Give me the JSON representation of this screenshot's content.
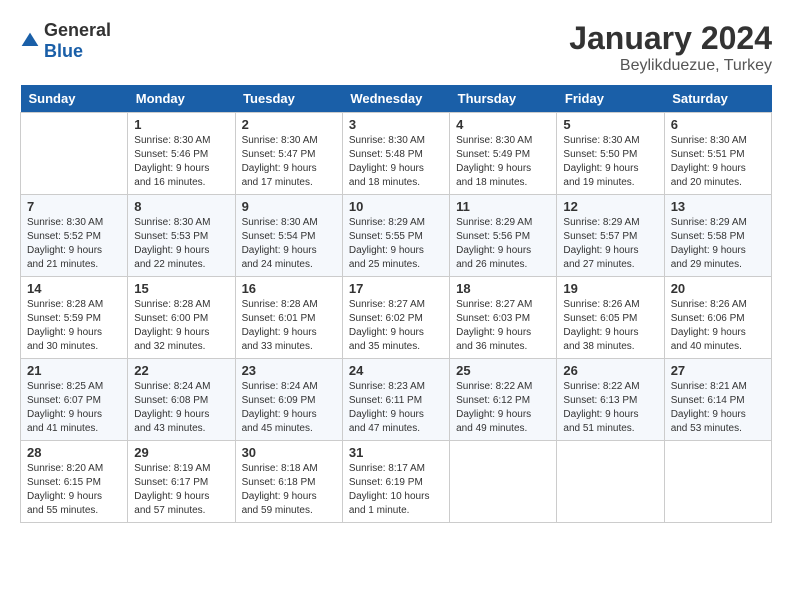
{
  "header": {
    "logo_general": "General",
    "logo_blue": "Blue",
    "month": "January 2024",
    "location": "Beylikduezue, Turkey"
  },
  "days_of_week": [
    "Sunday",
    "Monday",
    "Tuesday",
    "Wednesday",
    "Thursday",
    "Friday",
    "Saturday"
  ],
  "weeks": [
    [
      {
        "day": "",
        "sunrise": "",
        "sunset": "",
        "daylight": ""
      },
      {
        "day": "1",
        "sunrise": "Sunrise: 8:30 AM",
        "sunset": "Sunset: 5:46 PM",
        "daylight": "Daylight: 9 hours and 16 minutes."
      },
      {
        "day": "2",
        "sunrise": "Sunrise: 8:30 AM",
        "sunset": "Sunset: 5:47 PM",
        "daylight": "Daylight: 9 hours and 17 minutes."
      },
      {
        "day": "3",
        "sunrise": "Sunrise: 8:30 AM",
        "sunset": "Sunset: 5:48 PM",
        "daylight": "Daylight: 9 hours and 18 minutes."
      },
      {
        "day": "4",
        "sunrise": "Sunrise: 8:30 AM",
        "sunset": "Sunset: 5:49 PM",
        "daylight": "Daylight: 9 hours and 18 minutes."
      },
      {
        "day": "5",
        "sunrise": "Sunrise: 8:30 AM",
        "sunset": "Sunset: 5:50 PM",
        "daylight": "Daylight: 9 hours and 19 minutes."
      },
      {
        "day": "6",
        "sunrise": "Sunrise: 8:30 AM",
        "sunset": "Sunset: 5:51 PM",
        "daylight": "Daylight: 9 hours and 20 minutes."
      }
    ],
    [
      {
        "day": "7",
        "sunrise": "Sunrise: 8:30 AM",
        "sunset": "Sunset: 5:52 PM",
        "daylight": "Daylight: 9 hours and 21 minutes."
      },
      {
        "day": "8",
        "sunrise": "Sunrise: 8:30 AM",
        "sunset": "Sunset: 5:53 PM",
        "daylight": "Daylight: 9 hours and 22 minutes."
      },
      {
        "day": "9",
        "sunrise": "Sunrise: 8:30 AM",
        "sunset": "Sunset: 5:54 PM",
        "daylight": "Daylight: 9 hours and 24 minutes."
      },
      {
        "day": "10",
        "sunrise": "Sunrise: 8:29 AM",
        "sunset": "Sunset: 5:55 PM",
        "daylight": "Daylight: 9 hours and 25 minutes."
      },
      {
        "day": "11",
        "sunrise": "Sunrise: 8:29 AM",
        "sunset": "Sunset: 5:56 PM",
        "daylight": "Daylight: 9 hours and 26 minutes."
      },
      {
        "day": "12",
        "sunrise": "Sunrise: 8:29 AM",
        "sunset": "Sunset: 5:57 PM",
        "daylight": "Daylight: 9 hours and 27 minutes."
      },
      {
        "day": "13",
        "sunrise": "Sunrise: 8:29 AM",
        "sunset": "Sunset: 5:58 PM",
        "daylight": "Daylight: 9 hours and 29 minutes."
      }
    ],
    [
      {
        "day": "14",
        "sunrise": "Sunrise: 8:28 AM",
        "sunset": "Sunset: 5:59 PM",
        "daylight": "Daylight: 9 hours and 30 minutes."
      },
      {
        "day": "15",
        "sunrise": "Sunrise: 8:28 AM",
        "sunset": "Sunset: 6:00 PM",
        "daylight": "Daylight: 9 hours and 32 minutes."
      },
      {
        "day": "16",
        "sunrise": "Sunrise: 8:28 AM",
        "sunset": "Sunset: 6:01 PM",
        "daylight": "Daylight: 9 hours and 33 minutes."
      },
      {
        "day": "17",
        "sunrise": "Sunrise: 8:27 AM",
        "sunset": "Sunset: 6:02 PM",
        "daylight": "Daylight: 9 hours and 35 minutes."
      },
      {
        "day": "18",
        "sunrise": "Sunrise: 8:27 AM",
        "sunset": "Sunset: 6:03 PM",
        "daylight": "Daylight: 9 hours and 36 minutes."
      },
      {
        "day": "19",
        "sunrise": "Sunrise: 8:26 AM",
        "sunset": "Sunset: 6:05 PM",
        "daylight": "Daylight: 9 hours and 38 minutes."
      },
      {
        "day": "20",
        "sunrise": "Sunrise: 8:26 AM",
        "sunset": "Sunset: 6:06 PM",
        "daylight": "Daylight: 9 hours and 40 minutes."
      }
    ],
    [
      {
        "day": "21",
        "sunrise": "Sunrise: 8:25 AM",
        "sunset": "Sunset: 6:07 PM",
        "daylight": "Daylight: 9 hours and 41 minutes."
      },
      {
        "day": "22",
        "sunrise": "Sunrise: 8:24 AM",
        "sunset": "Sunset: 6:08 PM",
        "daylight": "Daylight: 9 hours and 43 minutes."
      },
      {
        "day": "23",
        "sunrise": "Sunrise: 8:24 AM",
        "sunset": "Sunset: 6:09 PM",
        "daylight": "Daylight: 9 hours and 45 minutes."
      },
      {
        "day": "24",
        "sunrise": "Sunrise: 8:23 AM",
        "sunset": "Sunset: 6:11 PM",
        "daylight": "Daylight: 9 hours and 47 minutes."
      },
      {
        "day": "25",
        "sunrise": "Sunrise: 8:22 AM",
        "sunset": "Sunset: 6:12 PM",
        "daylight": "Daylight: 9 hours and 49 minutes."
      },
      {
        "day": "26",
        "sunrise": "Sunrise: 8:22 AM",
        "sunset": "Sunset: 6:13 PM",
        "daylight": "Daylight: 9 hours and 51 minutes."
      },
      {
        "day": "27",
        "sunrise": "Sunrise: 8:21 AM",
        "sunset": "Sunset: 6:14 PM",
        "daylight": "Daylight: 9 hours and 53 minutes."
      }
    ],
    [
      {
        "day": "28",
        "sunrise": "Sunrise: 8:20 AM",
        "sunset": "Sunset: 6:15 PM",
        "daylight": "Daylight: 9 hours and 55 minutes."
      },
      {
        "day": "29",
        "sunrise": "Sunrise: 8:19 AM",
        "sunset": "Sunset: 6:17 PM",
        "daylight": "Daylight: 9 hours and 57 minutes."
      },
      {
        "day": "30",
        "sunrise": "Sunrise: 8:18 AM",
        "sunset": "Sunset: 6:18 PM",
        "daylight": "Daylight: 9 hours and 59 minutes."
      },
      {
        "day": "31",
        "sunrise": "Sunrise: 8:17 AM",
        "sunset": "Sunset: 6:19 PM",
        "daylight": "Daylight: 10 hours and 1 minute."
      },
      {
        "day": "",
        "sunrise": "",
        "sunset": "",
        "daylight": ""
      },
      {
        "day": "",
        "sunrise": "",
        "sunset": "",
        "daylight": ""
      },
      {
        "day": "",
        "sunrise": "",
        "sunset": "",
        "daylight": ""
      }
    ]
  ]
}
